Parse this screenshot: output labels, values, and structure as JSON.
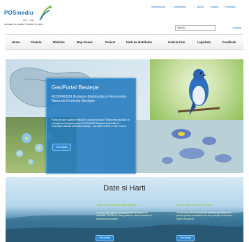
{
  "header": {
    "logo_main": "POSmediu",
    "logo_years": "2007 - 2013",
    "tagline": "Investim în mediu. Credem în viitor.",
    "top_links": [
      "Autentificare",
      "Înregistrare",
      "Suport",
      "Despre",
      "Feedback"
    ],
    "search_placeholder": "Search...",
    "search_button": "Cautare"
  },
  "nav": {
    "items": [
      "Home",
      "Căutare",
      "Răsfoire",
      "Map Viewer",
      "Proiect",
      "Harti de distributie",
      "Galerie Foto",
      "Legislatie",
      "Feedback"
    ]
  },
  "hero": {
    "title": "GeoPortal Bestepe",
    "subtitle": "ROSPA0009 Bestepe-Mahmudia si Rezervatia Naturala Dealurile Bestepe",
    "description": "Portal de date spatiale realizat in cadrul proiectului \"Elaborarea planului de management integrat pentru ROSPA0009 Bestepe-Mahmudia si rezervatia naturala Dealurile Bestepe\", cod SMIS-CSNR 17046, Tulcea.",
    "button": "Vezi detalii"
  },
  "section2": {
    "title": "Date si Harti",
    "columns": [
      {
        "title": "Cauta si vizualizeaza date spatiale",
        "text": "Cautare date spatiale prin intermediul catalogului de metadate. Vizualizare date spatiale in harta interactiva si descarcarea acestora.",
        "button": "Vezi detalii"
      },
      {
        "title": "Vizualizeaza sectiuni de harta",
        "text": "Vizualizeaza harti de distributie realizate prin fisiere pdf pentru speciile si habitatele din aria protejata si descarca harti in format pdf.",
        "button": "Vezi detalii"
      }
    ]
  },
  "colors": {
    "brand_blue": "#1a6fb5",
    "brand_green": "#7cb342",
    "panel_blue": "#1e78be",
    "section_green_title": "#8fcf4a"
  }
}
